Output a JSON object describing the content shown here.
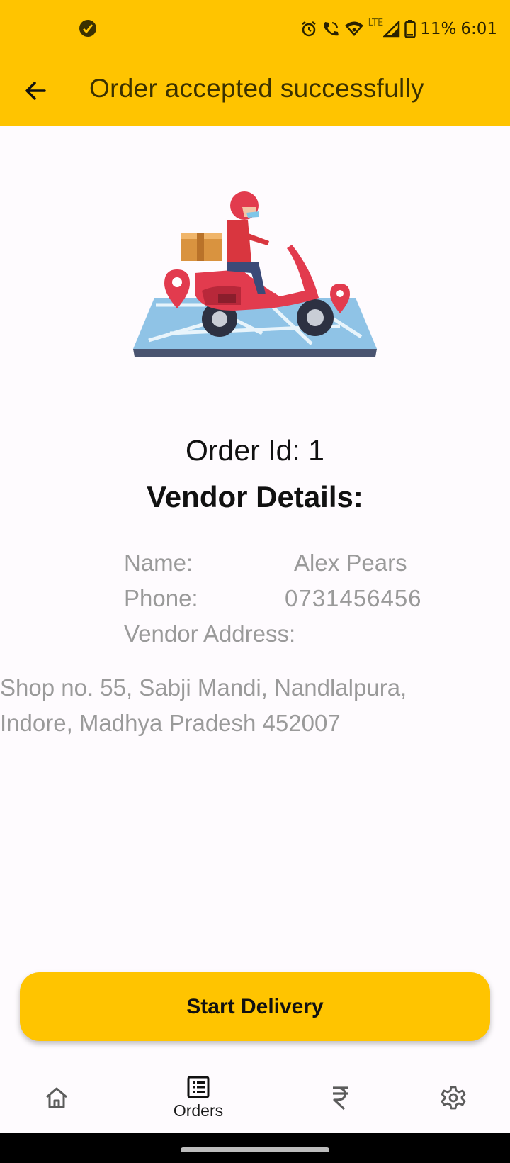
{
  "status_bar": {
    "battery": "11%",
    "time": "6:01",
    "network": "LTE",
    "icons": [
      "app-notification-icon",
      "alarm-icon",
      "wifi-calling-icon",
      "wifi-icon",
      "signal-icon",
      "battery-icon"
    ]
  },
  "app_bar": {
    "title": "Order accepted successfully",
    "back_icon": "arrow-left-icon"
  },
  "order": {
    "id_text": "Order Id: 1"
  },
  "vendor": {
    "heading": "Vendor Details:",
    "name_label": "Name:",
    "name_value": "Alex Pears",
    "phone_label": "Phone:",
    "phone_value": "0731456456",
    "address_label": "Vendor Address:",
    "address_line1": "Shop no. 55, Sabji Mandi, Nandlalpura,",
    "address_line2": "Indore, Madhya Pradesh 452007"
  },
  "actions": {
    "start_delivery": "Start Delivery"
  },
  "bottom_nav": {
    "items": [
      {
        "icon": "home-icon",
        "label": ""
      },
      {
        "icon": "list-icon",
        "label": "Orders",
        "active": true
      },
      {
        "icon": "rupee-icon",
        "label": ""
      },
      {
        "icon": "gear-icon",
        "label": ""
      }
    ]
  },
  "colors": {
    "accent": "#ffc400",
    "background": "#fefbfe",
    "muted_text": "#9a9a9a"
  }
}
